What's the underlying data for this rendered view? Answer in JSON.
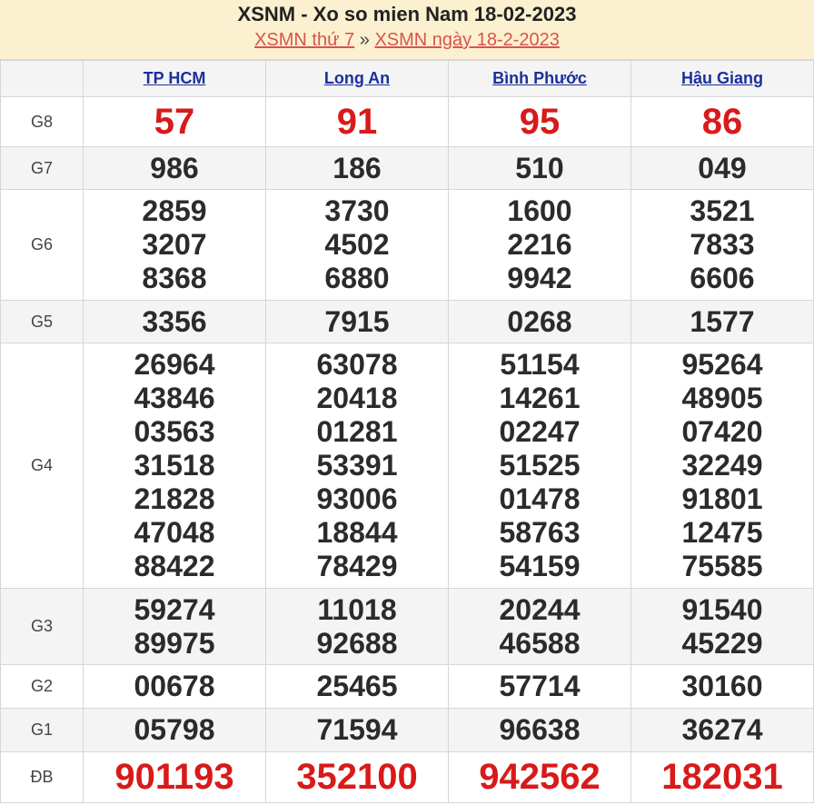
{
  "header": {
    "title": "XSNM - Xo so mien Nam 18-02-2023",
    "link1": "XSMN thứ 7",
    "separator": "»",
    "link2": "XSMN ngày 18-2-2023"
  },
  "provinces": [
    "TP HCM",
    "Long An",
    "Bình Phước",
    "Hậu Giang"
  ],
  "prizes": {
    "g8": {
      "label": "G8",
      "values": [
        "57",
        "91",
        "95",
        "86"
      ]
    },
    "g7": {
      "label": "G7",
      "values": [
        "986",
        "186",
        "510",
        "049"
      ]
    },
    "g6": {
      "label": "G6",
      "values": [
        [
          "2859",
          "3207",
          "8368"
        ],
        [
          "3730",
          "4502",
          "6880"
        ],
        [
          "1600",
          "2216",
          "9942"
        ],
        [
          "3521",
          "7833",
          "6606"
        ]
      ]
    },
    "g5": {
      "label": "G5",
      "values": [
        "3356",
        "7915",
        "0268",
        "1577"
      ]
    },
    "g4": {
      "label": "G4",
      "values": [
        [
          "26964",
          "43846",
          "03563",
          "31518",
          "21828",
          "47048",
          "88422"
        ],
        [
          "63078",
          "20418",
          "01281",
          "53391",
          "93006",
          "18844",
          "78429"
        ],
        [
          "51154",
          "14261",
          "02247",
          "51525",
          "01478",
          "58763",
          "54159"
        ],
        [
          "95264",
          "48905",
          "07420",
          "32249",
          "91801",
          "12475",
          "75585"
        ]
      ]
    },
    "g3": {
      "label": "G3",
      "values": [
        [
          "59274",
          "89975"
        ],
        [
          "11018",
          "92688"
        ],
        [
          "20244",
          "46588"
        ],
        [
          "91540",
          "45229"
        ]
      ]
    },
    "g2": {
      "label": "G2",
      "values": [
        "00678",
        "25465",
        "57714",
        "30160"
      ]
    },
    "g1": {
      "label": "G1",
      "values": [
        "05798",
        "71594",
        "96638",
        "36274"
      ]
    },
    "db": {
      "label": "ĐB",
      "values": [
        "901193",
        "352100",
        "942562",
        "182031"
      ]
    }
  },
  "colors": {
    "header_bg": "#fbf0cf",
    "special_red": "#d81a1a",
    "link_red": "#d9534f",
    "province_blue": "#1c2f9c"
  }
}
